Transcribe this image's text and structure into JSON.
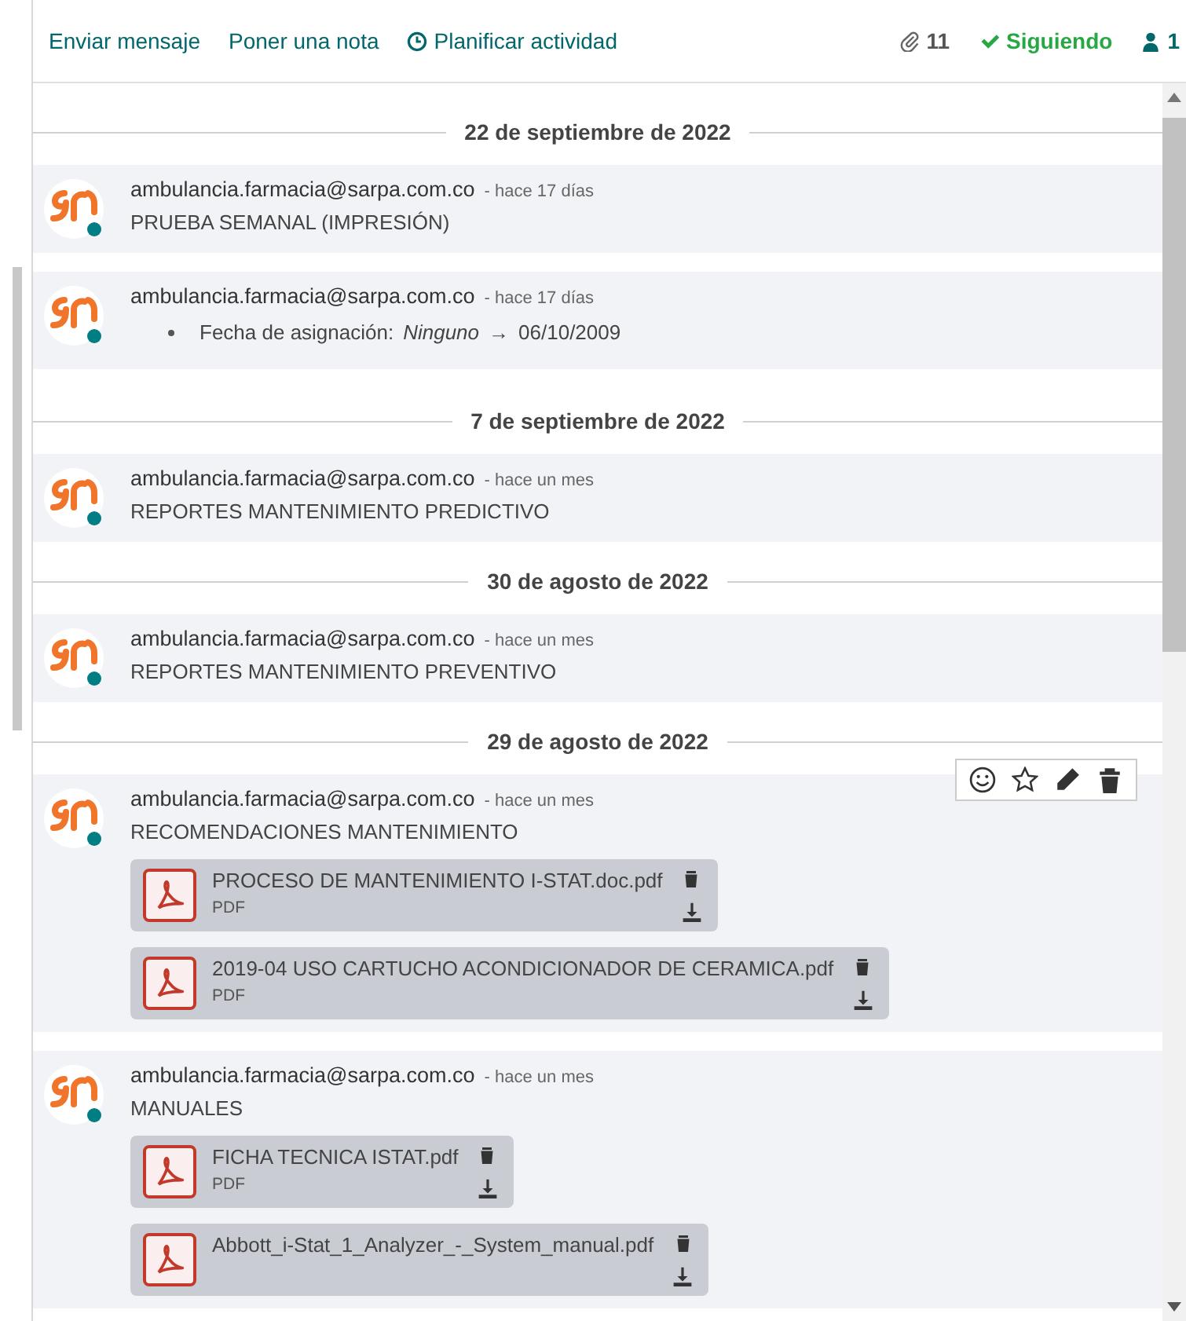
{
  "toolbar": {
    "actions": [
      {
        "label": "Enviar mensaje",
        "kind": "plain"
      },
      {
        "label": "Poner una nota",
        "kind": "plain"
      },
      {
        "label": "Planificar actividad",
        "kind": "activity"
      }
    ],
    "attachments_count": "11",
    "follow": {
      "label": "Siguiendo",
      "following": true
    },
    "followers_count": "1"
  },
  "groups": [
    {
      "date": "22 de septiembre de 2022",
      "messages": [
        {
          "author": "ambulancia.farmacia@sarpa.com.co",
          "time": "- hace 17 días",
          "kind": "body",
          "body": "PRUEBA SEMANAL (IMPRESIÓN)",
          "hover": false
        },
        {
          "author": "ambulancia.farmacia@sarpa.com.co",
          "time": "- hace 17 días",
          "kind": "tracking",
          "field": "Fecha de asignación:",
          "old": "Ninguno",
          "arrow": "→",
          "new": "06/10/2009",
          "hover": false
        }
      ]
    },
    {
      "date": "7 de septiembre de 2022",
      "messages": [
        {
          "author": "ambulancia.farmacia@sarpa.com.co",
          "time": "- hace un mes",
          "kind": "body",
          "body": "REPORTES MANTENIMIENTO PREDICTIVO",
          "hover": false
        }
      ]
    },
    {
      "date": "30 de agosto de 2022",
      "messages": [
        {
          "author": "ambulancia.farmacia@sarpa.com.co",
          "time": "- hace un mes",
          "kind": "body",
          "body": "REPORTES MANTENIMIENTO PREVENTIVO",
          "hover": false
        }
      ]
    },
    {
      "date": "29 de agosto de 2022",
      "messages": [
        {
          "author": "ambulancia.farmacia@sarpa.com.co",
          "time": "- hace un mes",
          "kind": "body",
          "body": "RECOMENDACIONES MANTENIMIENTO",
          "hover": true,
          "attachments": [
            {
              "name": "PROCESO DE MANTENIMIENTO I-STAT.doc.pdf",
              "type": "PDF"
            },
            {
              "name": "2019-04 USO CARTUCHO ACONDICIONADOR DE CERAMICA.pdf",
              "type": "PDF"
            }
          ]
        },
        {
          "author": "ambulancia.farmacia@sarpa.com.co",
          "time": "- hace un mes",
          "kind": "body",
          "body": "MANUALES",
          "hover": false,
          "attachments": [
            {
              "name": "FICHA TECNICA ISTAT.pdf",
              "type": "PDF"
            },
            {
              "name": "Abbott_i-Stat_1_Analyzer_-_System_manual.pdf"
            }
          ]
        }
      ]
    }
  ]
}
